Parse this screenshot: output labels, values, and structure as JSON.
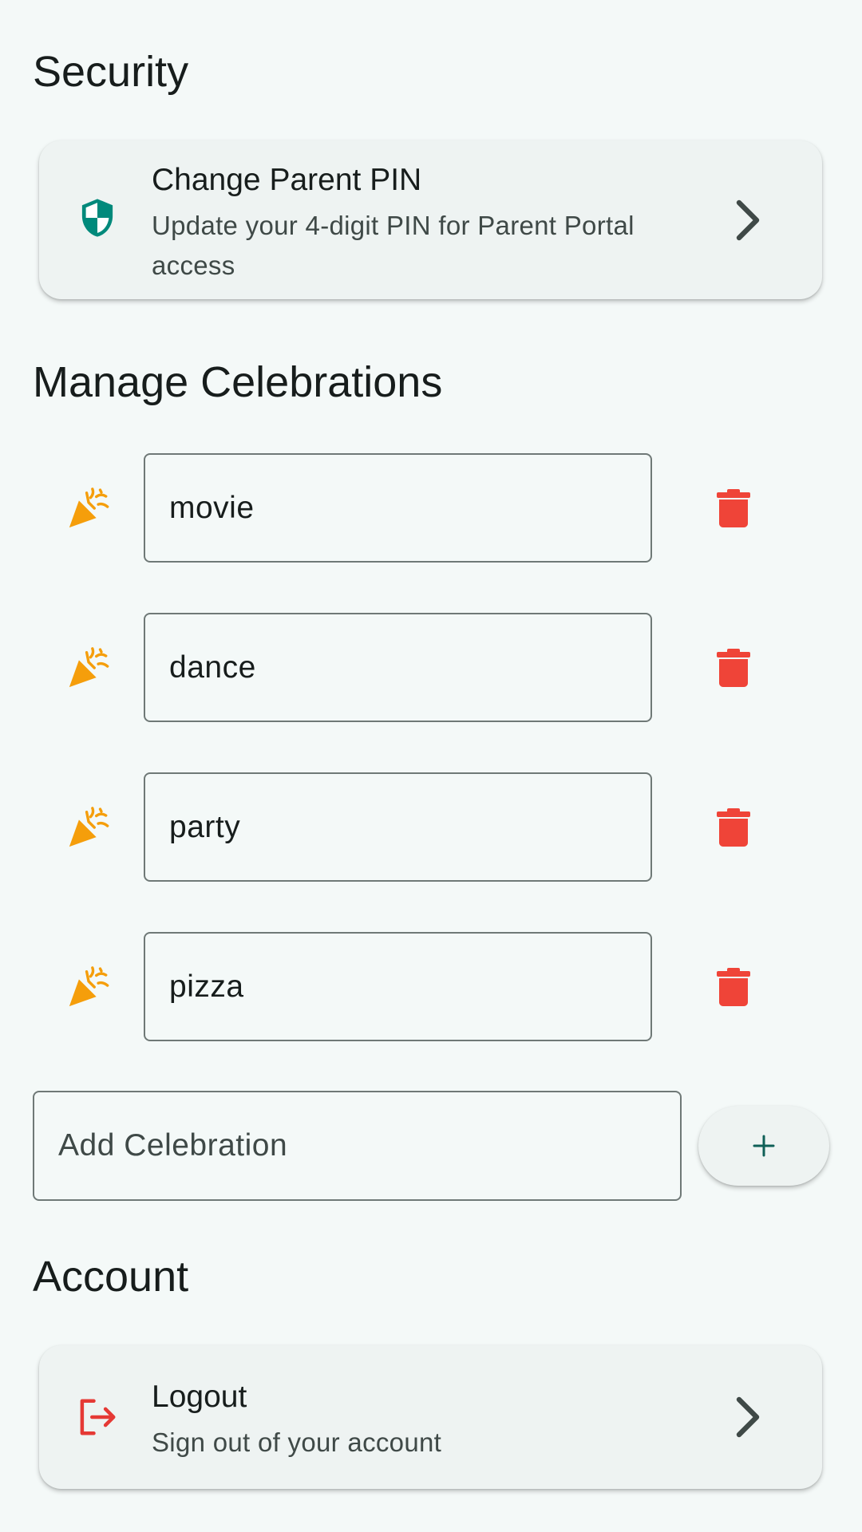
{
  "security": {
    "heading": "Security",
    "change_pin": {
      "title": "Change Parent PIN",
      "subtitle": "Update your 4-digit PIN for Parent Portal access",
      "icon": "shield-icon",
      "accent": "#00897b"
    }
  },
  "celebrations": {
    "heading": "Manage Celebrations",
    "items": [
      {
        "value": "movie"
      },
      {
        "value": "dance"
      },
      {
        "value": "party"
      },
      {
        "value": "pizza"
      }
    ],
    "item_icon": "party-popper-icon",
    "delete_icon": "trash-icon",
    "add": {
      "placeholder": "Add Celebration",
      "value": "",
      "button_icon": "plus-icon"
    },
    "icon_color": "#f59e0b",
    "delete_color": "#ef4438"
  },
  "account": {
    "heading": "Account",
    "logout": {
      "title": "Logout",
      "subtitle": "Sign out of your account",
      "icon": "logout-icon",
      "accent": "#e53935"
    }
  }
}
